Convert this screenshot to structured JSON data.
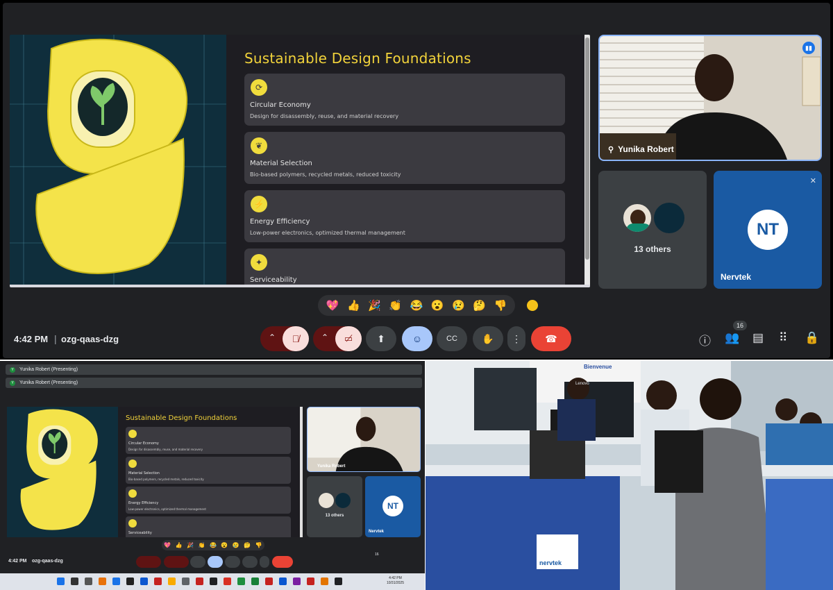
{
  "meeting": {
    "time": "4:42 PM",
    "separator": "|",
    "code": "ozg-qaas-dzg",
    "participant_count": "16"
  },
  "slide": {
    "title": "Sustainable Design Foundations",
    "cards": [
      {
        "title": "Circular Economy",
        "desc": "Design for disassembly, reuse, and material recovery"
      },
      {
        "title": "Material Selection",
        "desc": "Bio-based polymers, recycled metals, reduced toxicity"
      },
      {
        "title": "Energy Efficiency",
        "desc": "Low-power electronics, optimized thermal management"
      },
      {
        "title": "Serviceability",
        "desc": ""
      }
    ]
  },
  "tiles": {
    "speaker_name": "Yunika Robert",
    "others_label": "13 others",
    "nervtek_name": "Nervtek",
    "nervtek_logo": "NT"
  },
  "reactions": [
    "💖",
    "👍",
    "🎉",
    "👏",
    "😂",
    "😮",
    "😢",
    "🤔",
    "👎"
  ],
  "controls": {
    "caret": "^",
    "more": "⋮"
  },
  "small_screen": {
    "presenting_rows": [
      "Yunika Robert (Presenting)",
      "Yunika Robert (Presenting)"
    ],
    "avatar_letter": "Y",
    "taskbar_time": "4:42 PM",
    "taskbar_date": "10/31/2025"
  },
  "photo": {
    "poster_text": "Bienvenue",
    "monitor_brand": "Lenovo",
    "banner_logo": "nervtek"
  },
  "colors": {
    "accent_yellow": "#f2d33b",
    "end_call": "#ea4335",
    "nervtek_blue": "#1a5aa3",
    "speaker_border": "#8ab4f8"
  }
}
